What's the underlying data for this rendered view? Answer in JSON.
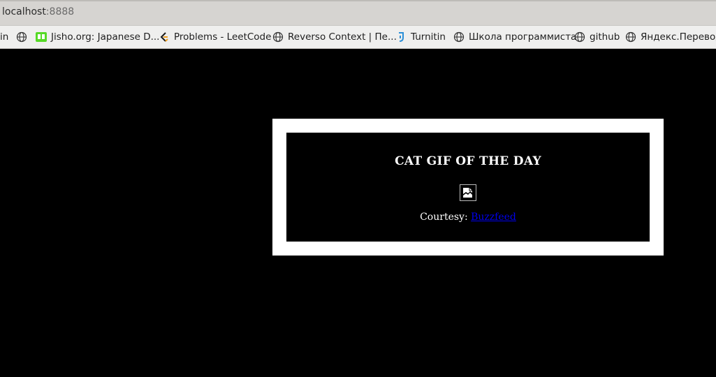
{
  "browser": {
    "url_host": "localhost",
    "url_port": ":8888"
  },
  "bookmarks": [
    {
      "label": "in",
      "icon": "none"
    },
    {
      "label": "",
      "icon": "globe-icon"
    },
    {
      "label": "Jisho.org: Japanese D...",
      "icon": "jisho-icon"
    },
    {
      "label": "Problems - LeetCode",
      "icon": "leetcode-icon"
    },
    {
      "label": "Reverso Context | Пе...",
      "icon": "globe-icon"
    },
    {
      "label": "Turnitin",
      "icon": "turnitin-icon"
    },
    {
      "label": "Школа программиста",
      "icon": "globe-icon"
    },
    {
      "label": "github",
      "icon": "globe-icon"
    },
    {
      "label": "Яндекс.Переводч",
      "icon": "globe-icon"
    }
  ],
  "page": {
    "title": "CAT GIF OF THE DAY",
    "image_icon": "broken-image-icon",
    "courtesy_label": "Courtesy: ",
    "courtesy_link": "Buzzfeed"
  }
}
